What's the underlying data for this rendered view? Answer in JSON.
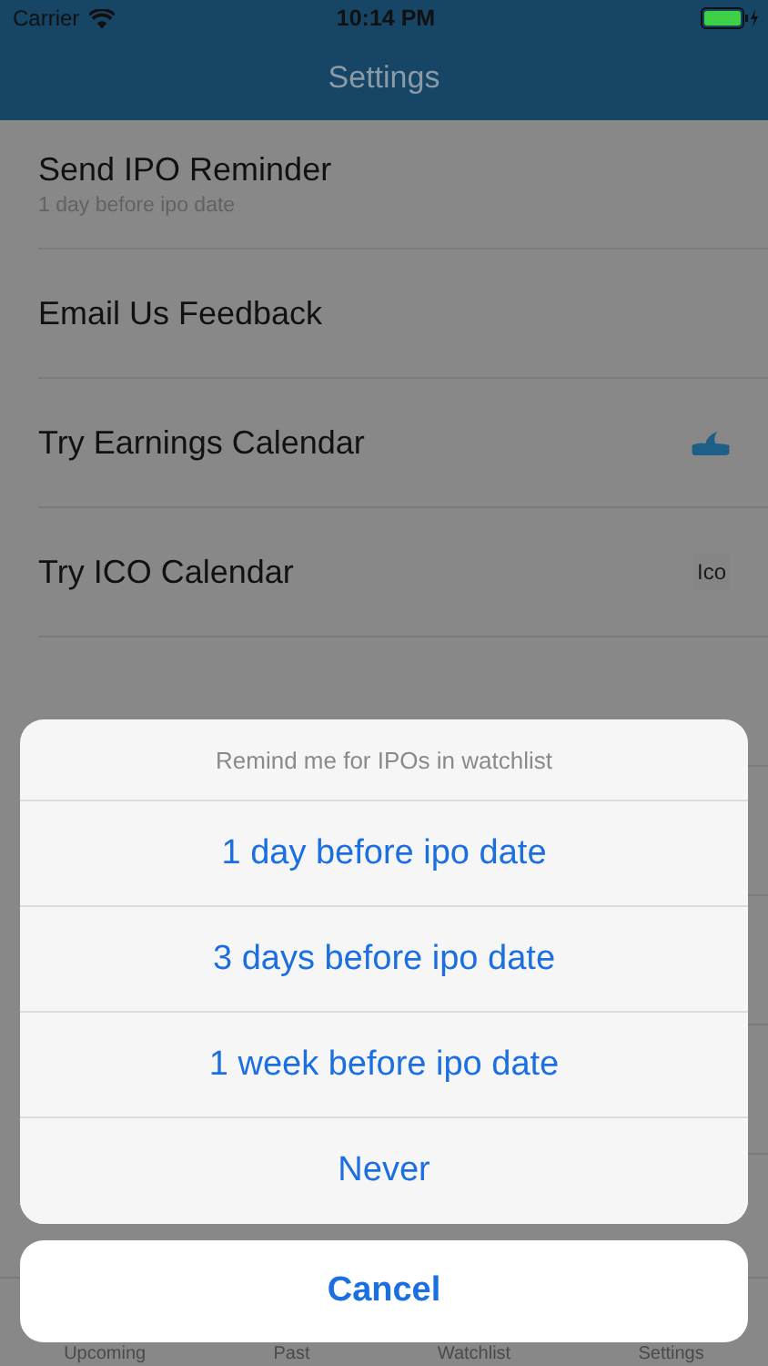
{
  "status_bar": {
    "carrier": "Carrier",
    "time": "10:14 PM"
  },
  "nav": {
    "title": "Settings"
  },
  "rows": [
    {
      "title": "Send IPO Reminder",
      "subtitle": "1 day before ipo date"
    },
    {
      "title": "Email Us Feedback"
    },
    {
      "title": "Try Earnings Calendar",
      "accessory": {
        "kind": "icon"
      }
    },
    {
      "title": "Try ICO Calendar",
      "accessory": {
        "kind": "text",
        "text": "Ico"
      }
    }
  ],
  "tabs": [
    "Upcoming",
    "Past",
    "Watchlist",
    "Settings"
  ],
  "action_sheet": {
    "title": "Remind me for IPOs in watchlist",
    "options": [
      "1 day before ipo date",
      "3 days before ipo date",
      "1 week before ipo date",
      "Never"
    ],
    "cancel": "Cancel"
  }
}
